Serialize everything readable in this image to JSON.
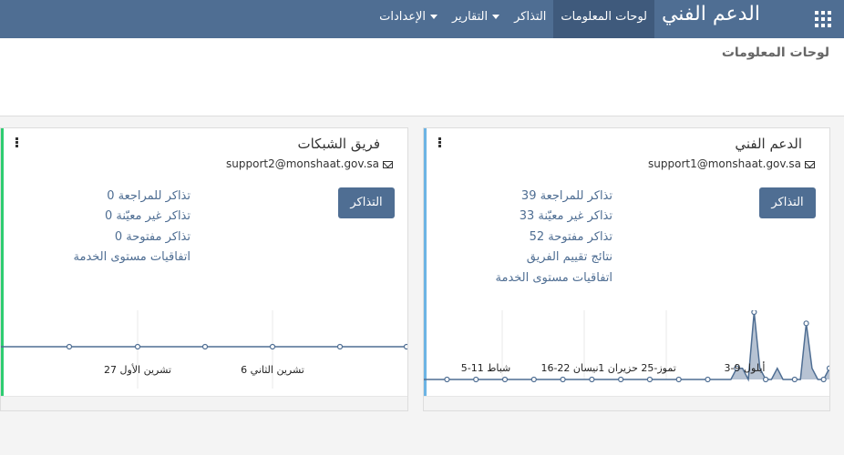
{
  "app": {
    "title": "الدعم الفني",
    "apps_icon": "apps-grid-icon",
    "menu": [
      {
        "label": "لوحات المعلومات",
        "active": true,
        "has_caret": false
      },
      {
        "label": "التذاكر",
        "active": false,
        "has_caret": false
      },
      {
        "label": "التقارير",
        "active": false,
        "has_caret": true
      },
      {
        "label": "الإعدادات",
        "active": false,
        "has_caret": true
      }
    ]
  },
  "breadcrumb": "لوحات المعلومات",
  "cards": [
    {
      "title": "الدعم الفني",
      "email": "support1@monshaat.gov.sa",
      "button": "التذاكر",
      "accent": "#6cb4e4",
      "links": [
        "39 تذاكر للمراجعة",
        "33 تذاكر غير معيّنة",
        "52 تذاكر مفتوحة",
        "نتائج تقييم الفريق",
        "اتفاقيات مستوى الخدمة"
      ],
      "chart_data": {
        "type": "area",
        "title": "",
        "xlabel": "",
        "ylabel": "",
        "x_tick_labels": [
          "5-11 شباط",
          "16-22 نيسان",
          "1 تموز-25 حزيران",
          "3-9 أيلول"
        ],
        "values": [
          0,
          0,
          0,
          0,
          0,
          0,
          0,
          0,
          0,
          0,
          0,
          0,
          0,
          0,
          0,
          0,
          0,
          0,
          0,
          0,
          0,
          0,
          0,
          0,
          0,
          0,
          0,
          0,
          0,
          0,
          0,
          0,
          0,
          0,
          0,
          0,
          0,
          0,
          0,
          0,
          0,
          0,
          0,
          0,
          0,
          0,
          0,
          0,
          0,
          0,
          0,
          0,
          0,
          0,
          1,
          1,
          0,
          6,
          1,
          0,
          0,
          1,
          0,
          0,
          0,
          0,
          5,
          1,
          0,
          0,
          1
        ],
        "marker_every": 5,
        "color": "#4f6e93",
        "fill": "#b7c3d3",
        "ylim": [
          0,
          6
        ]
      }
    },
    {
      "title": "فريق الشبكات",
      "email": "support2@monshaat.gov.sa",
      "button": "التذاكر",
      "accent": "#2ecc71",
      "links": [
        "0 تذاكر للمراجعة",
        "0 تذاكر غير معيّنة",
        "0 تذاكر مفتوحة",
        "اتفاقيات مستوى الخدمة"
      ],
      "chart_data": {
        "type": "line",
        "title": "",
        "xlabel": "",
        "ylabel": "",
        "x_tick_labels": [
          "27 تشرين الأول",
          "6 تشرين الثاني"
        ],
        "values": [
          0,
          0,
          0,
          0,
          0,
          0,
          0
        ],
        "color": "#4f6e93",
        "ylim": [
          0,
          1
        ]
      }
    }
  ]
}
